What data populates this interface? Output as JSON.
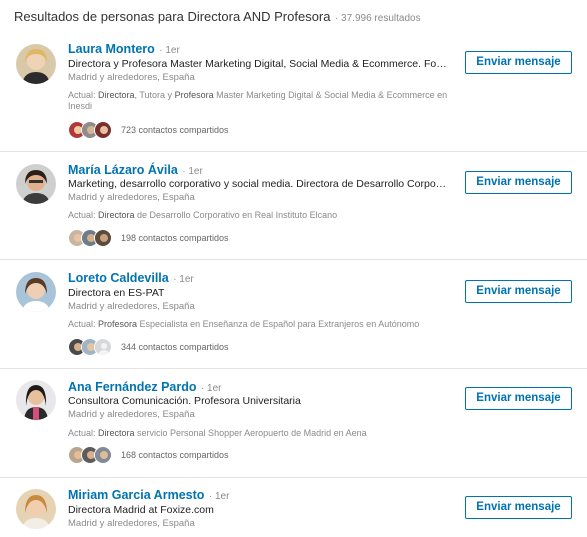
{
  "header": {
    "title": "Resultados de personas para Directora AND Profesora",
    "count": "· 37.996 resultados"
  },
  "results": [
    {
      "name": "Laura Montero",
      "degree": "· 1er",
      "headline": "Directora y Profesora Master Marketing Digital, Social Media & Ecommerce. Formadora en Marketing Online",
      "location": "Madrid y alrededores, España",
      "current": {
        "label": "Actual: ",
        "parts": [
          "Directora",
          ", Tutora y ",
          "Profesora",
          " Master Marketing Digital & Social Media & Ecommerce en Inesdi"
        ]
      },
      "shared": "723 contactos compartidos",
      "button": "Enviar mensaje"
    },
    {
      "name": "María Lázaro Ávila",
      "degree": "· 1er",
      "headline": "Marketing, desarrollo corporativo y social media. Directora de Desarrollo Corporativo en Real Instituto Elcano",
      "location": "Madrid y alrededores, España",
      "current": {
        "label": "Actual: ",
        "parts": [
          "Directora",
          " de Desarrollo Corporativo en Real Instituto Elcano"
        ]
      },
      "shared": "198 contactos compartidos",
      "button": "Enviar mensaje"
    },
    {
      "name": "Loreto Caldevilla",
      "degree": "· 1er",
      "headline": "Directora en ES-PAT",
      "location": "Madrid y alrededores, España",
      "current": {
        "label": "Actual: ",
        "parts": [
          "Profesora",
          " Especialista en Enseñanza de Español para Extranjeros en Autónomo"
        ]
      },
      "shared": "344 contactos compartidos",
      "button": "Enviar mensaje"
    },
    {
      "name": "Ana Fernández Pardo",
      "degree": "· 1er",
      "headline": "Consultora Comunicación. Profesora Universitaria",
      "location": "Madrid y alrededores, España",
      "current": {
        "label": "Actual: ",
        "parts": [
          "Directora",
          " servicio Personal Shopper Aeropuerto de Madrid en Aena"
        ]
      },
      "shared": "168 contactos compartidos",
      "button": "Enviar mensaje"
    },
    {
      "name": "Miriam Garcia Armesto",
      "degree": "· 1er",
      "headline": "Directora Madrid at Foxize.com",
      "location": "Madrid y alrededores, España",
      "button": "Enviar mensaje"
    }
  ]
}
